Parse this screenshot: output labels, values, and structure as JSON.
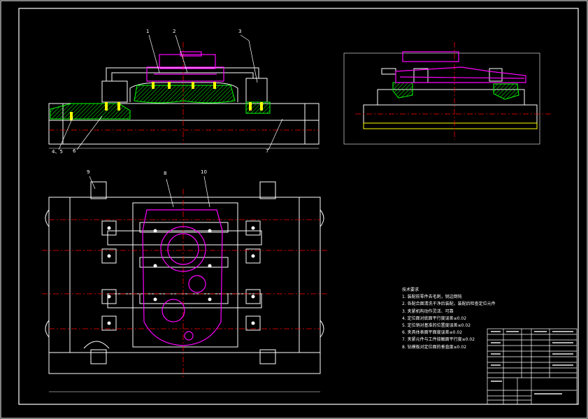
{
  "drawing": {
    "callouts": [
      "1",
      "2",
      "3",
      "4、5",
      "6",
      "7",
      "8",
      "9",
      "10"
    ],
    "notes": {
      "heading": "技术要求",
      "items": [
        "1. 装配前零件去毛刺，锐边倒钝",
        "2. 各配合面清洗干净后装配，装配后检查定位元件",
        "3. 夹紧机构动作灵活、可靠",
        "4. 定位面对底面平行度误差≤0.02",
        "5. 定位销对基准的位置度误差≤0.02",
        "6. 夹具体表面平面度误差≤0.02",
        "7. 夹紧元件与工件接触面平行度≤0.02",
        "8. 钻模板对定位面的垂直度≤0.02"
      ]
    },
    "colors": {
      "outline": "#ffffff",
      "workpiece": "#ff00ff",
      "centerline": "#ff0000",
      "section_hatch": "#00ff00",
      "dimension": "#ffff00"
    }
  }
}
